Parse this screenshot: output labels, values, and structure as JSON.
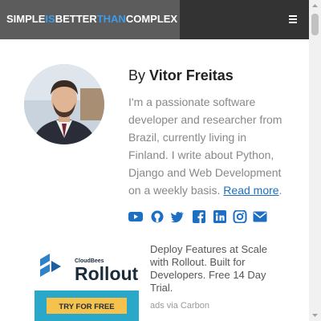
{
  "header": {
    "brand": {
      "simple": "SIMPLE",
      "is": "IS",
      "better": "BETTER",
      "than": "THAN",
      "complex": "COMPLEX"
    },
    "menu_icon": "menu-icon"
  },
  "author": {
    "by": "By",
    "name": "Vitor Freitas",
    "bio": "I'm a passionate software developer and researcher from Brazil, currently living in Finland. I write about Python, Django and Web Development on a weekly basis.",
    "read_more": "Read more",
    "period": ".",
    "social_icons": [
      "youtube-icon",
      "github-icon",
      "twitter-icon",
      "facebook-icon",
      "linkedin-icon",
      "instagram-icon",
      "email-icon"
    ]
  },
  "ad": {
    "logo_small": "CloudBees",
    "logo_main": "Rollout",
    "cta": "TRY FOR FREE",
    "title": "Deploy Features at Scale with Rollout. Built for Developers. Free 14 Day Trial.",
    "via": "ads via Carbon"
  },
  "colors": {
    "accent": "#1c6fc2",
    "brand_highlight": "#3e9be8",
    "topbar": "#333333",
    "brand_bg": "#5c5c5c",
    "ad_banner": "#2aa8c9",
    "ad_button": "#f6c24e"
  }
}
